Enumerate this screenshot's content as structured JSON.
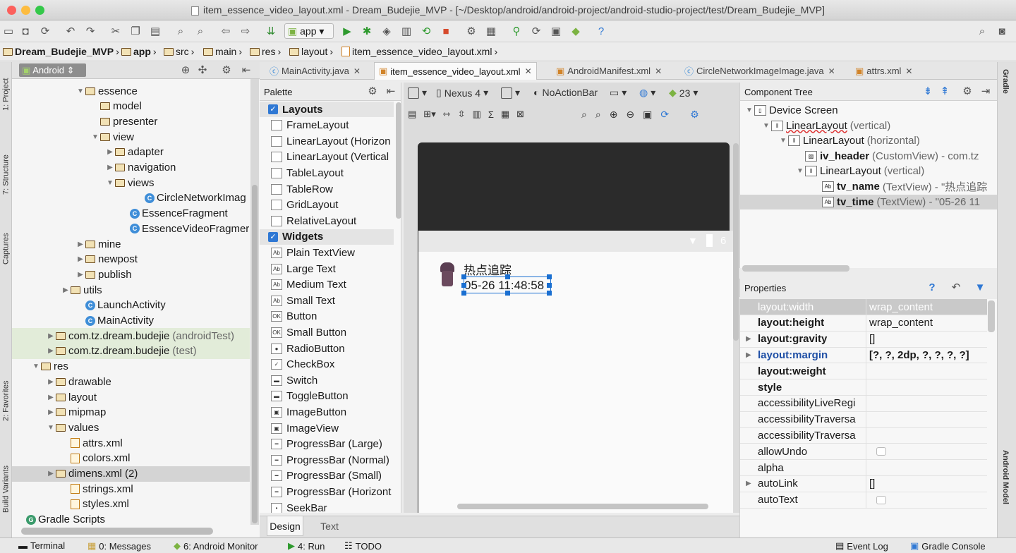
{
  "window": {
    "title": "item_essence_video_layout.xml - Dream_Budejie_MVP - [~/Desktop/android/android-project/android-studio-project/test/Dream_Budejie_MVP]"
  },
  "toolbar": {
    "run_config": "app"
  },
  "breadcrumbs": [
    "Dream_Budejie_MVP",
    "app",
    "src",
    "main",
    "res",
    "layout",
    "item_essence_video_layout.xml"
  ],
  "left_strip": [
    "1: Project",
    "7: Structure",
    "Captures",
    "2: Favorites",
    "Build Variants"
  ],
  "right_strip": [
    "Gradle",
    "Android Model"
  ],
  "project_panel": {
    "view_mode": "Android"
  },
  "tree": [
    {
      "label": "essence",
      "indent": 4,
      "arrow": "▼",
      "icon": "folder"
    },
    {
      "label": "model",
      "indent": 5,
      "arrow": "",
      "icon": "folder"
    },
    {
      "label": "presenter",
      "indent": 5,
      "arrow": "",
      "icon": "folder"
    },
    {
      "label": "view",
      "indent": 5,
      "arrow": "▼",
      "icon": "folder"
    },
    {
      "label": "adapter",
      "indent": 6,
      "arrow": "▶",
      "icon": "folder"
    },
    {
      "label": "navigation",
      "indent": 6,
      "arrow": "▶",
      "icon": "folder"
    },
    {
      "label": "views",
      "indent": 6,
      "arrow": "▼",
      "icon": "folder"
    },
    {
      "label": "CircleNetworkImag",
      "indent": 8,
      "arrow": "",
      "icon": "class"
    },
    {
      "label": "EssenceFragment",
      "indent": 7,
      "arrow": "",
      "icon": "class"
    },
    {
      "label": "EssenceVideoFragmer",
      "indent": 7,
      "arrow": "",
      "icon": "class"
    },
    {
      "label": "mine",
      "indent": 4,
      "arrow": "▶",
      "icon": "folder"
    },
    {
      "label": "newpost",
      "indent": 4,
      "arrow": "▶",
      "icon": "folder"
    },
    {
      "label": "publish",
      "indent": 4,
      "arrow": "▶",
      "icon": "folder"
    },
    {
      "label": "utils",
      "indent": 3,
      "arrow": "▶",
      "icon": "folder"
    },
    {
      "label": "LaunchActivity",
      "indent": 4,
      "arrow": "",
      "icon": "class"
    },
    {
      "label": "MainActivity",
      "indent": 4,
      "arrow": "",
      "icon": "class"
    },
    {
      "label": "com.tz.dream.budejie",
      "suffix": "(androidTest)",
      "indent": 2,
      "arrow": "▶",
      "icon": "folder",
      "alt": true
    },
    {
      "label": "com.tz.dream.budejie",
      "suffix": "(test)",
      "indent": 2,
      "arrow": "▶",
      "icon": "folder",
      "alt": true
    },
    {
      "label": "res",
      "indent": 1,
      "arrow": "▼",
      "icon": "folder"
    },
    {
      "label": "drawable",
      "indent": 2,
      "arrow": "▶",
      "icon": "folder"
    },
    {
      "label": "layout",
      "indent": 2,
      "arrow": "▶",
      "icon": "folder"
    },
    {
      "label": "mipmap",
      "indent": 2,
      "arrow": "▶",
      "icon": "folder"
    },
    {
      "label": "values",
      "indent": 2,
      "arrow": "▼",
      "icon": "folder"
    },
    {
      "label": "attrs.xml",
      "indent": 3,
      "arrow": "",
      "icon": "file"
    },
    {
      "label": "colors.xml",
      "indent": 3,
      "arrow": "",
      "icon": "file"
    },
    {
      "label": "dimens.xml (2)",
      "indent": 2,
      "arrow": "▶",
      "icon": "folder",
      "sel": true
    },
    {
      "label": "strings.xml",
      "indent": 3,
      "arrow": "",
      "icon": "file"
    },
    {
      "label": "styles.xml",
      "indent": 3,
      "arrow": "",
      "icon": "file"
    },
    {
      "label": "Gradle Scripts",
      "indent": 0,
      "arrow": "",
      "icon": "gradle"
    }
  ],
  "editor_tabs": [
    {
      "label": "MainActivity.java",
      "active": false
    },
    {
      "label": "item_essence_video_layout.xml",
      "active": true
    },
    {
      "label": "AndroidManifest.xml",
      "active": false
    },
    {
      "label": "CircleNetworkImageImage.java",
      "active": false
    },
    {
      "label": "attrs.xml",
      "active": false
    }
  ],
  "palette": {
    "title": "Palette",
    "items": [
      {
        "label": "Layouts",
        "group": true
      },
      {
        "label": "FrameLayout"
      },
      {
        "label": "LinearLayout (Horizon"
      },
      {
        "label": "LinearLayout (Vertical"
      },
      {
        "label": "TableLayout"
      },
      {
        "label": "TableRow"
      },
      {
        "label": "GridLayout"
      },
      {
        "label": "RelativeLayout"
      },
      {
        "label": "Widgets",
        "group": true
      },
      {
        "label": "Plain TextView",
        "ico": "Ab"
      },
      {
        "label": "Large Text",
        "ico": "Ab"
      },
      {
        "label": "Medium Text",
        "ico": "Ab"
      },
      {
        "label": "Small Text",
        "ico": "Ab"
      },
      {
        "label": "Button",
        "ico": "OK"
      },
      {
        "label": "Small Button",
        "ico": "OK"
      },
      {
        "label": "RadioButton",
        "ico": "●"
      },
      {
        "label": "CheckBox",
        "ico": "✓"
      },
      {
        "label": "Switch",
        "ico": "▬"
      },
      {
        "label": "ToggleButton",
        "ico": "▬"
      },
      {
        "label": "ImageButton",
        "ico": "▣"
      },
      {
        "label": "ImageView",
        "ico": "▣"
      },
      {
        "label": "ProgressBar (Large)",
        "ico": "━"
      },
      {
        "label": "ProgressBar (Normal)",
        "ico": "━"
      },
      {
        "label": "ProgressBar (Small)",
        "ico": "━"
      },
      {
        "label": "ProgressBar (Horizont",
        "ico": "━"
      },
      {
        "label": "SeekBar",
        "ico": "•"
      }
    ]
  },
  "design_toolbar": {
    "device": "Nexus 4",
    "theme": "NoActionBar",
    "api": "23"
  },
  "preview": {
    "name_text": "热点追踪",
    "time_text": "05-26 11:48:58",
    "status_clip": "6"
  },
  "component_tree": {
    "title": "Component Tree",
    "rows": [
      {
        "label": "Device Screen",
        "meta": "",
        "indent": 0,
        "arrow": "▼",
        "ico": "▯"
      },
      {
        "label": "LinearLayout",
        "meta": "(vertical)",
        "indent": 1,
        "arrow": "▼",
        "ico": "‖",
        "error": true
      },
      {
        "label": "LinearLayout",
        "meta": "(horizontal)",
        "indent": 2,
        "arrow": "▼",
        "ico": "‖"
      },
      {
        "label": "iv_header",
        "meta": "(CustomView) - com.tz",
        "indent": 3,
        "arrow": "",
        "ico": "▨",
        "bold": true
      },
      {
        "label": "LinearLayout",
        "meta": "(vertical)",
        "indent": 3,
        "arrow": "▼",
        "ico": "‖"
      },
      {
        "label": "tv_name",
        "meta": "(TextView) - \"热点追踪",
        "indent": 4,
        "arrow": "",
        "ico": "Ab",
        "bold": true
      },
      {
        "label": "tv_time",
        "meta": "(TextView) - \"05-26 11",
        "indent": 4,
        "arrow": "",
        "ico": "Ab",
        "bold": true,
        "sel": true
      }
    ]
  },
  "properties": {
    "title": "Properties",
    "rows": [
      {
        "name": "layout:width",
        "value": "wrap_content",
        "grey": true
      },
      {
        "name": "layout:height",
        "value": "wrap_content",
        "bold": true
      },
      {
        "name": "layout:gravity",
        "value": "[]",
        "bold": true,
        "exp": true
      },
      {
        "name": "layout:margin",
        "value": "[?, ?, 2dp, ?, ?, ?, ?]",
        "bold": true,
        "exp": true,
        "blue": true
      },
      {
        "name": "layout:weight",
        "value": "",
        "bold": true
      },
      {
        "name": "style",
        "value": "",
        "bold": true
      },
      {
        "name": "accessibilityLiveRegi",
        "value": ""
      },
      {
        "name": "accessibilityTraversa",
        "value": ""
      },
      {
        "name": "accessibilityTraversa",
        "value": ""
      },
      {
        "name": "allowUndo",
        "value": "",
        "checkbox": true
      },
      {
        "name": "alpha",
        "value": ""
      },
      {
        "name": "autoLink",
        "value": "[]",
        "exp": true
      },
      {
        "name": "autoText",
        "value": "",
        "checkbox": true
      }
    ]
  },
  "design_tabs": [
    "Design",
    "Text"
  ],
  "status_bar": {
    "left": [
      {
        "label": "Terminal"
      },
      {
        "label": "0: Messages"
      },
      {
        "label": "6: Android Monitor"
      },
      {
        "label": "4: Run"
      },
      {
        "label": "TODO"
      }
    ],
    "right": [
      {
        "label": "Event Log"
      },
      {
        "label": "Gradle Console"
      }
    ]
  },
  "colors": {
    "accent": "#2f78d4",
    "selection": "#d4d4d4",
    "test_bg": "#e2ecd9",
    "handle": "#1a6fd1"
  }
}
